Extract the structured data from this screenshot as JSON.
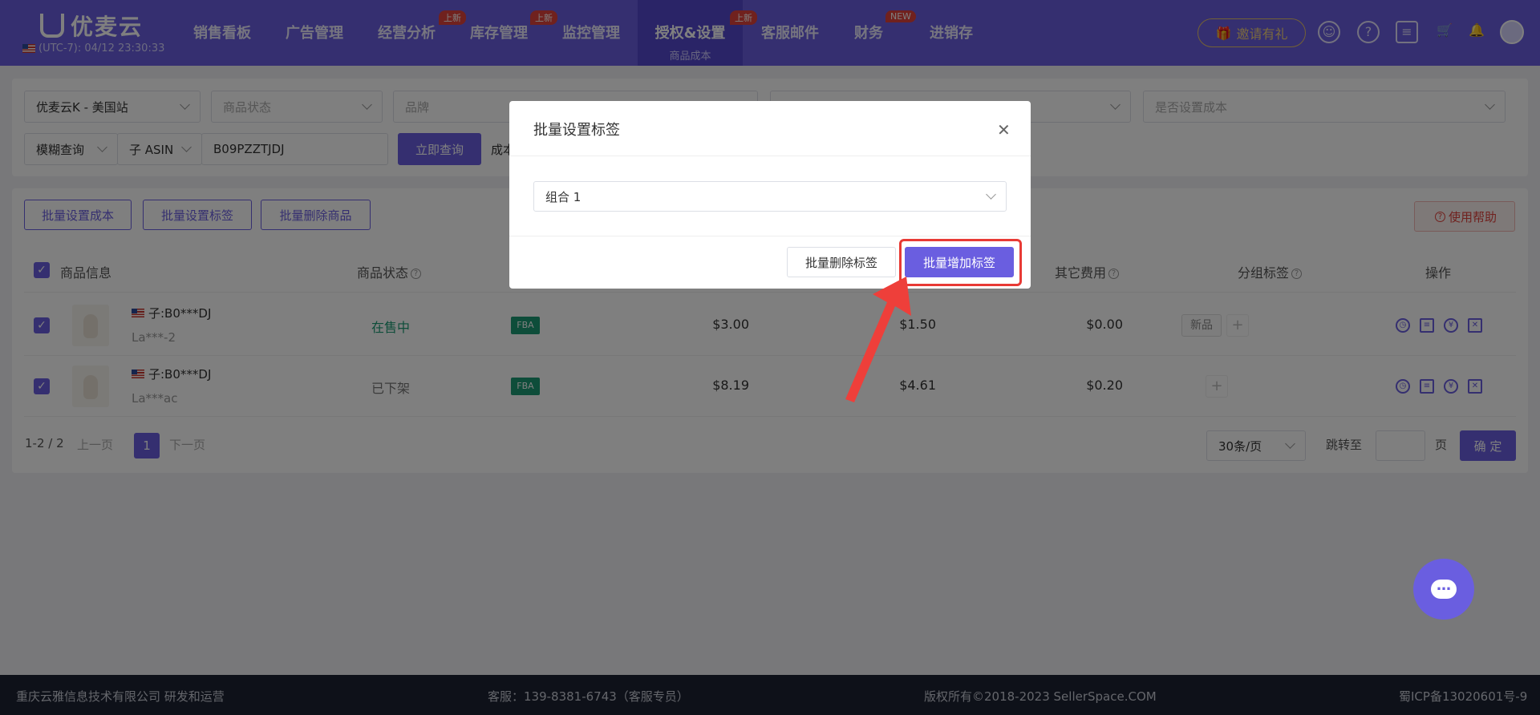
{
  "header": {
    "logo_text": "优麦云",
    "clock": "(UTC-7): 04/12 23:30:33",
    "nav": [
      {
        "label": "销售看板"
      },
      {
        "label": "广告管理"
      },
      {
        "label": "经营分析",
        "badge": "上新"
      },
      {
        "label": "库存管理",
        "badge": "上新"
      },
      {
        "label": "监控管理"
      },
      {
        "label": "授权&设置",
        "badge": "上新",
        "sub": "商品成本"
      },
      {
        "label": "客服邮件"
      },
      {
        "label": "财务",
        "badge": "NEW"
      },
      {
        "label": "进销存"
      }
    ],
    "invite": "邀请有礼"
  },
  "filters": {
    "site": "优麦云K - 美国站",
    "status_placeholder": "商品状态",
    "brand_placeholder": "品牌",
    "cost_placeholder": "是否设置成本",
    "search_mode": "模糊查询",
    "search_field": "子 ASIN",
    "search_value": "B09PZZTJDJ",
    "query_button": "立即查询",
    "cost_label": "成本"
  },
  "toolbar": {
    "set_cost": "批量设置成本",
    "set_tag": "批量设置标签",
    "delete_products": "批量删除商品",
    "help": "使用帮助"
  },
  "table": {
    "headers": {
      "info": "商品信息",
      "status": "商品状态",
      "other_fee": "其它费用",
      "group_tag": "分组标签",
      "actions": "操作"
    },
    "rows": [
      {
        "asin": "子:B0***DJ",
        "sku": "La***-2",
        "status": "在售中",
        "status_color": "#1c9b74",
        "fulfillment": "FBA",
        "price": "$3.00",
        "fee": "$1.50",
        "other": "$0.00",
        "tag": "新品"
      },
      {
        "asin": "子:B0***DJ",
        "sku": "La***ac",
        "status": "已下架",
        "status_color": "#777777",
        "fulfillment": "FBA",
        "price": "$8.19",
        "fee": "$4.61",
        "other": "$0.20",
        "tag": ""
      }
    ]
  },
  "pagination": {
    "range": "1-2",
    "total": "2",
    "prev": "上一页",
    "current": "1",
    "next": "下一页",
    "page_size": "30条/页",
    "jump_label": "跳转至",
    "page_unit": "页",
    "confirm": "确 定"
  },
  "dialog": {
    "title": "批量设置标签",
    "select_value": "组合 1",
    "remove_button": "批量删除标签",
    "add_button": "批量增加标签"
  },
  "footer": {
    "company": "重庆云雅信息技术有限公司 研发和运营",
    "support": "客服：139-8381-6743（客服专员）",
    "copyright": "版权所有©2018-2023 SellerSpace.COM",
    "icp": "蜀ICP备13020601号-9"
  },
  "colors": {
    "brand": "#6a5ee0",
    "highlight": "#e83a35",
    "footer_bg": "#1d2233"
  }
}
